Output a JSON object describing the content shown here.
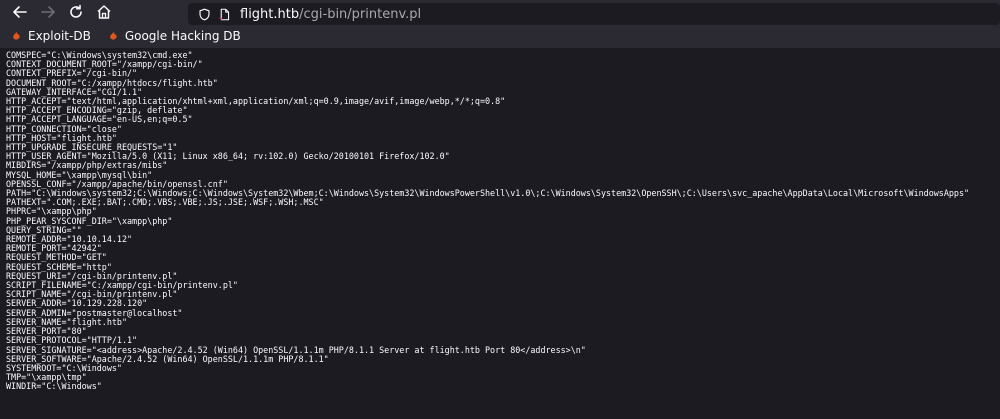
{
  "browser": {
    "url_host": "flight.htb",
    "url_path": "/cgi-bin/printenv.pl",
    "icons": {
      "back": "back-arrow-icon",
      "forward": "forward-arrow-icon",
      "reload": "reload-icon",
      "home": "home-icon",
      "shield": "shield-icon",
      "page": "page-icon"
    }
  },
  "bookmarks": [
    {
      "label": "Exploit-DB",
      "icon": "exploit-db-icon",
      "color": "#e0561f"
    },
    {
      "label": "Google Hacking DB",
      "icon": "ghdb-icon",
      "color": "#e0561f"
    }
  ],
  "env_lines": [
    "COMSPEC=\"C:\\Windows\\system32\\cmd.exe\"",
    "CONTEXT_DOCUMENT_ROOT=\"/xampp/cgi-bin/\"",
    "CONTEXT_PREFIX=\"/cgi-bin/\"",
    "DOCUMENT_ROOT=\"C:/xampp/htdocs/flight.htb\"",
    "GATEWAY_INTERFACE=\"CGI/1.1\"",
    "HTTP_ACCEPT=\"text/html,application/xhtml+xml,application/xml;q=0.9,image/avif,image/webp,*/*;q=0.8\"",
    "HTTP_ACCEPT_ENCODING=\"gzip, deflate\"",
    "HTTP_ACCEPT_LANGUAGE=\"en-US,en;q=0.5\"",
    "HTTP_CONNECTION=\"close\"",
    "HTTP_HOST=\"flight.htb\"",
    "HTTP_UPGRADE_INSECURE_REQUESTS=\"1\"",
    "HTTP_USER_AGENT=\"Mozilla/5.0 (X11; Linux x86_64; rv:102.0) Gecko/20100101 Firefox/102.0\"",
    "MIBDIRS=\"/xampp/php/extras/mibs\"",
    "MYSQL_HOME=\"\\xampp\\mysql\\bin\"",
    "OPENSSL_CONF=\"/xampp/apache/bin/openssl.cnf\"",
    "PATH=\"C:\\Windows\\system32;C:\\Windows;C:\\Windows\\System32\\Wbem;C:\\Windows\\System32\\WindowsPowerShell\\v1.0\\;C:\\Windows\\System32\\OpenSSH\\;C:\\Users\\svc_apache\\AppData\\Local\\Microsoft\\WindowsApps\"",
    "PATHEXT=\".COM;.EXE;.BAT;.CMD;.VBS;.VBE;.JS;.JSE;.WSF;.WSH;.MSC\"",
    "PHPRC=\"\\xampp\\php\"",
    "PHP_PEAR_SYSCONF_DIR=\"\\xampp\\php\"",
    "QUERY_STRING=\"\"",
    "REMOTE_ADDR=\"10.10.14.12\"",
    "REMOTE_PORT=\"42942\"",
    "REQUEST_METHOD=\"GET\"",
    "REQUEST_SCHEME=\"http\"",
    "REQUEST_URI=\"/cgi-bin/printenv.pl\"",
    "SCRIPT_FILENAME=\"C:/xampp/cgi-bin/printenv.pl\"",
    "SCRIPT_NAME=\"/cgi-bin/printenv.pl\"",
    "SERVER_ADDR=\"10.129.228.120\"",
    "SERVER_ADMIN=\"postmaster@localhost\"",
    "SERVER_NAME=\"flight.htb\"",
    "SERVER_PORT=\"80\"",
    "SERVER_PROTOCOL=\"HTTP/1.1\"",
    "SERVER_SIGNATURE=\"<address>Apache/2.4.52 (Win64) OpenSSL/1.1.1m PHP/8.1.1 Server at flight.htb Port 80</address>\\n\"",
    "SERVER_SOFTWARE=\"Apache/2.4.52 (Win64) OpenSSL/1.1.1m PHP/8.1.1\"",
    "SYSTEMROOT=\"C:\\Windows\"",
    "TMP=\"\\xampp\\tmp\"",
    "WINDIR=\"C:\\Windows\""
  ]
}
